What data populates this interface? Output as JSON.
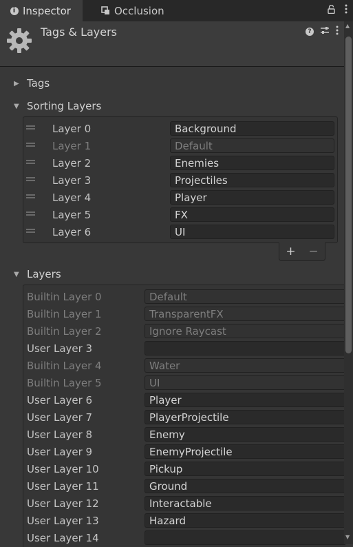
{
  "tabs": [
    {
      "label": "Inspector",
      "icon": "info-icon",
      "active": true
    },
    {
      "label": "Occlusion",
      "icon": "occlusion-icon",
      "active": false
    }
  ],
  "header": {
    "title": "Tags & Layers"
  },
  "sections": {
    "tags": {
      "label": "Tags",
      "expanded": false
    },
    "sorting_layers": {
      "label": "Sorting Layers",
      "expanded": true
    },
    "layers": {
      "label": "Layers",
      "expanded": true
    }
  },
  "sorting_layers": [
    {
      "label": "Layer 0",
      "value": "Background",
      "disabled": false
    },
    {
      "label": "Layer 1",
      "value": "Default",
      "disabled": true
    },
    {
      "label": "Layer 2",
      "value": "Enemies",
      "disabled": false
    },
    {
      "label": "Layer 3",
      "value": "Projectiles",
      "disabled": false
    },
    {
      "label": "Layer 4",
      "value": "Player",
      "disabled": false
    },
    {
      "label": "Layer 5",
      "value": "FX",
      "disabled": false
    },
    {
      "label": "Layer 6",
      "value": "UI",
      "disabled": false
    }
  ],
  "list_buttons": {
    "add": "+",
    "remove": "−"
  },
  "layers": [
    {
      "label": "Builtin Layer 0",
      "value": "Default",
      "disabled": true
    },
    {
      "label": "Builtin Layer 1",
      "value": "TransparentFX",
      "disabled": true
    },
    {
      "label": "Builtin Layer 2",
      "value": "Ignore Raycast",
      "disabled": true
    },
    {
      "label": "User Layer 3",
      "value": "",
      "disabled": false
    },
    {
      "label": "Builtin Layer 4",
      "value": "Water",
      "disabled": true
    },
    {
      "label": "Builtin Layer 5",
      "value": "UI",
      "disabled": true
    },
    {
      "label": "User Layer 6",
      "value": "Player",
      "disabled": false
    },
    {
      "label": "User Layer 7",
      "value": "PlayerProjectile",
      "disabled": false
    },
    {
      "label": "User Layer 8",
      "value": "Enemy",
      "disabled": false
    },
    {
      "label": "User Layer 9",
      "value": "EnemyProjectile",
      "disabled": false
    },
    {
      "label": "User Layer 10",
      "value": "Pickup",
      "disabled": false
    },
    {
      "label": "User Layer 11",
      "value": "Ground",
      "disabled": false
    },
    {
      "label": "User Layer 12",
      "value": "Interactable",
      "disabled": false
    },
    {
      "label": "User Layer 13",
      "value": "Hazard",
      "disabled": false
    },
    {
      "label": "User Layer 14",
      "value": "",
      "disabled": false
    }
  ],
  "colors": {
    "background": "#383838",
    "field": "#2a2a2a",
    "tabbar": "#282828"
  }
}
